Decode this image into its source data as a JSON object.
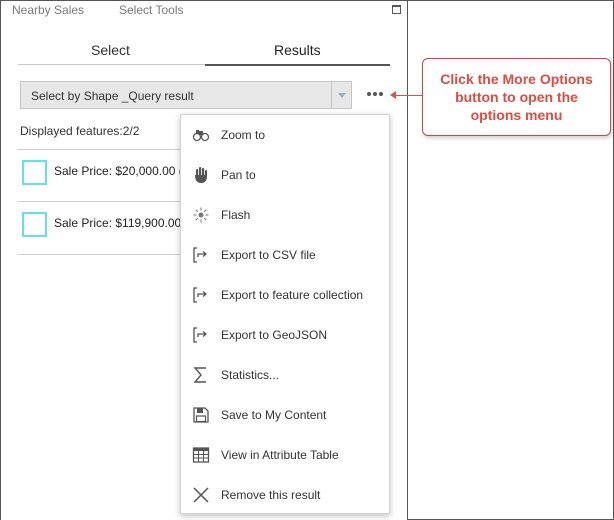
{
  "header": {
    "tabs": [
      "Nearby Sales",
      "Select Tools"
    ]
  },
  "tabs": {
    "select_label": "Select",
    "results_label": "Results",
    "active": "Results"
  },
  "dropdown": {
    "value": "Select by Shape _Query result"
  },
  "features": {
    "count_text": "Displayed features:2/2"
  },
  "results": [
    {
      "label": "Sale Price: $20,000.00 ("
    },
    {
      "label": "Sale Price: $119,900.00"
    }
  ],
  "menu": {
    "items": [
      {
        "label": "Zoom to",
        "icon": "zoom-to-icon"
      },
      {
        "label": "Pan to",
        "icon": "pan-hand-icon"
      },
      {
        "label": "Flash",
        "icon": "flash-icon"
      },
      {
        "label": "Export to CSV file",
        "icon": "export-icon"
      },
      {
        "label": "Export to feature collection",
        "icon": "export-icon"
      },
      {
        "label": "Export to GeoJSON",
        "icon": "export-icon"
      },
      {
        "label": "Statistics...",
        "icon": "sigma-icon"
      },
      {
        "label": "Save to My Content",
        "icon": "save-disk-icon"
      },
      {
        "label": "View in Attribute Table",
        "icon": "table-icon"
      },
      {
        "label": "Remove this result",
        "icon": "close-x-icon"
      }
    ]
  },
  "callout": {
    "text": "Click the More Options button to open the options menu"
  },
  "colors": {
    "swatch": "#63e0e8",
    "callout": "#e04a3f",
    "dropdown_bg": "#e7e7e7"
  }
}
